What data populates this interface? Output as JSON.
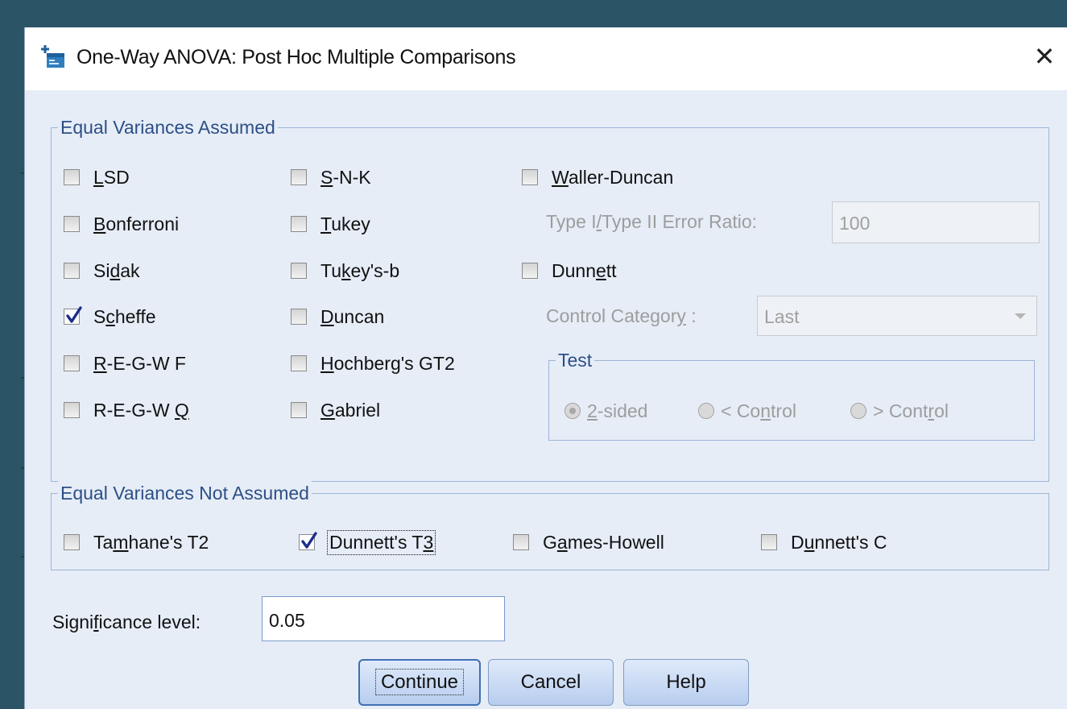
{
  "dialog": {
    "title": "One-Way ANOVA: Post Hoc Multiple Comparisons",
    "close_glyph": "✕",
    "icon": "spss-dialog-icon"
  },
  "equal_assumed": {
    "legend": "Equal Variances Assumed",
    "col1": [
      {
        "pre": "",
        "u": "L",
        "post": "SD",
        "checked": false
      },
      {
        "pre": "",
        "u": "B",
        "post": "onferroni",
        "checked": false
      },
      {
        "pre": "Si",
        "u": "d",
        "post": "ak",
        "checked": false
      },
      {
        "pre": "S",
        "u": "c",
        "post": "heffe",
        "checked": true
      },
      {
        "pre": "",
        "u": "R",
        "post": "-E-G-W F",
        "checked": false
      },
      {
        "pre": "R-E-G-W ",
        "u": "Q",
        "post": "",
        "checked": false
      }
    ],
    "col2": [
      {
        "pre": "",
        "u": "S",
        "post": "-N-K",
        "checked": false
      },
      {
        "pre": "",
        "u": "T",
        "post": "ukey",
        "checked": false
      },
      {
        "pre": "Tu",
        "u": "k",
        "post": "ey's-b",
        "checked": false
      },
      {
        "pre": "",
        "u": "D",
        "post": "uncan",
        "checked": false
      },
      {
        "pre": "",
        "u": "H",
        "post": "ochberg's GT2",
        "checked": false
      },
      {
        "pre": "",
        "u": "G",
        "post": "abriel",
        "checked": false
      }
    ],
    "waller": {
      "pre": "",
      "u": "W",
      "post": "aller-Duncan",
      "checked": false
    },
    "error_ratio": {
      "pre": "Type I",
      "u": "/",
      "post": "Type II Error Ratio:",
      "value": "100"
    },
    "dunnett": {
      "pre": "Dunn",
      "u": "e",
      "post": "tt",
      "checked": false
    },
    "control_category": {
      "pre": "Control Categor",
      "u": "y",
      "post": " :",
      "value": "Last"
    },
    "test": {
      "legend": "Test",
      "options": [
        {
          "u": "2",
          "post": "-sided",
          "pre": "",
          "selected": true
        },
        {
          "pre": "< Co",
          "u": "n",
          "post": "trol",
          "selected": false
        },
        {
          "pre": "> Cont",
          "u": "r",
          "post": "ol",
          "selected": false
        }
      ]
    }
  },
  "not_assumed": {
    "legend": "Equal Variances Not Assumed",
    "items": [
      {
        "pre": "Ta",
        "u": "m",
        "post": "hane's T2",
        "checked": false
      },
      {
        "pre": "Dunnett's T",
        "u": "3",
        "post": "",
        "checked": true
      },
      {
        "pre": "G",
        "u": "a",
        "post": "mes-Howell",
        "checked": false
      },
      {
        "pre": "D",
        "u": "u",
        "post": "nnett's C",
        "checked": false
      }
    ]
  },
  "significance": {
    "pre": "Signi",
    "u": "f",
    "post": "icance level:",
    "value": "0.05"
  },
  "buttons": {
    "continue": "Continue",
    "cancel": "Cancel",
    "help": "Help"
  },
  "colors": {
    "accent": "#2d4f86",
    "check": "#1a2e8c",
    "desktop": "#2b5566"
  }
}
